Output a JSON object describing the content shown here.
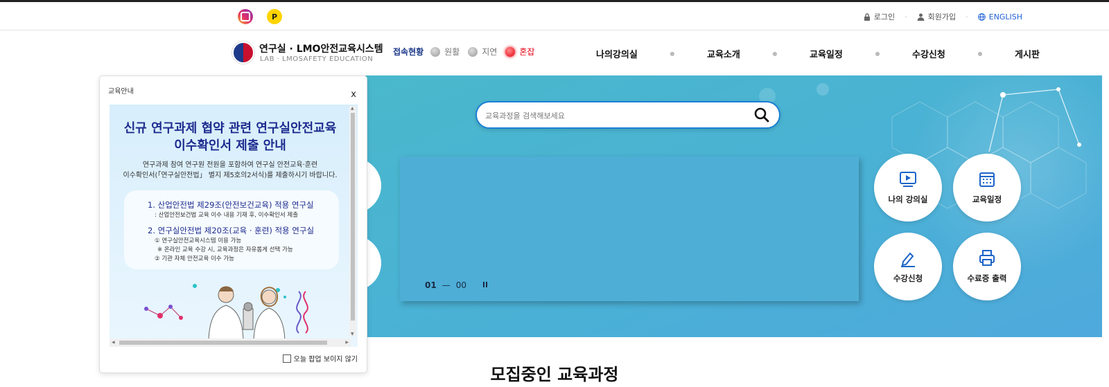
{
  "topbar": {
    "social": [
      "instagram-icon",
      "point-icon"
    ],
    "login_label": "로그인",
    "signup_label": "회원가입",
    "english_label": "ENGLISH"
  },
  "header": {
    "logo_title": "연구실 · LMO안전교육시스템",
    "logo_sub": "LAB · LMOSAFETY EDUCATION",
    "status_title": "접속현황",
    "status_items": [
      "원활",
      "지연",
      "혼잡"
    ],
    "status_colors": {
      "active": "#e60012",
      "inactive": "#999999"
    },
    "nav": [
      "나의강의실",
      "교육소개",
      "교육일정",
      "수강신청",
      "게시판"
    ]
  },
  "search": {
    "placeholder": "교육과정을 검색해보세요"
  },
  "slider": {
    "current": "01",
    "total": "00"
  },
  "quick_menu": [
    "나의 강의실",
    "교육일정",
    "수강신청",
    "수료증 출력"
  ],
  "popup": {
    "title": "교육안내",
    "close_label": "x",
    "content": {
      "heading_line1": "신규 연구과제 협약 관련 연구실안전교육",
      "heading_line2": "이수확인서 제출 안내",
      "desc_line1": "연구과제 참여 연구원 전원을 포함하여 연구실 안전교육·훈련",
      "desc_line2": "이수확인서(「연구실안전법」 별지 제5호의2서식)를 제출하시기 바랍니다.",
      "item1": "1. 산업안전법 제29조(안전보건교육) 적용 연구실",
      "item1_sub": ": 산업안전보건법 교육 이수 내용 기재 후, 이수확인서 제출",
      "item2": "2. 연구실안전법 제20조(교육 · 훈련) 적용 연구실",
      "item2_sub1": "① 연구실안전교육시스템 이용 가능",
      "item2_sub2": "※ 온라인 교육 수강 시, 교육과정은 자유롭게 선택 가능",
      "item2_sub3": "② 기관 자체 안전교육 이수 가능"
    },
    "dont_show_label": "오늘 팝업 보이지 않기"
  },
  "section": {
    "title": "모집중인 교육과정"
  },
  "colors": {
    "brand_blue": "#1e2c8f",
    "accent_blue": "#1b80d6",
    "hero": "#4ab0d6"
  }
}
